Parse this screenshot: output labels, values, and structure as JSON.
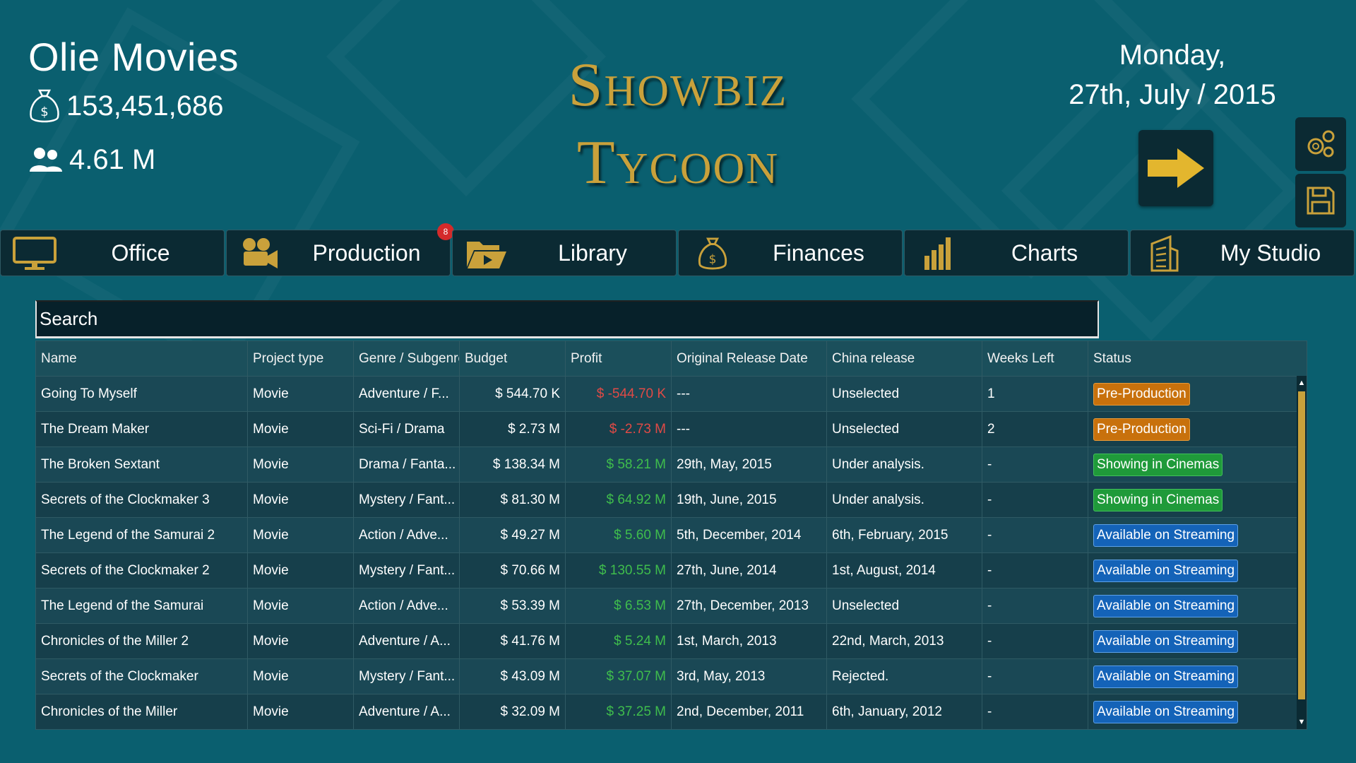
{
  "header": {
    "company_name": "Olie Movies",
    "money": "153,451,686",
    "fans": "4.61 M",
    "date_line1": "Monday,",
    "date_line2": "27th, July / 2015"
  },
  "logo": {
    "line1": "Showbiz",
    "line2": "Tycoon"
  },
  "nav": [
    {
      "label": "Office",
      "icon": "monitor-icon"
    },
    {
      "label": "Production",
      "icon": "camera-icon",
      "badge": "8"
    },
    {
      "label": "Library",
      "icon": "folder-play-icon"
    },
    {
      "label": "Finances",
      "icon": "money-bag-icon"
    },
    {
      "label": "Charts",
      "icon": "bar-chart-icon"
    },
    {
      "label": "My Studio",
      "icon": "building-icon"
    }
  ],
  "search": {
    "placeholder": "Search"
  },
  "colors": {
    "accent_gold": "#c9a13b",
    "bg_teal": "#0a5f6f",
    "panel_dark": "#0b2a33"
  },
  "table": {
    "columns": [
      "Name",
      "Project type",
      "Genre / Subgenre",
      "Budget",
      "Profit",
      "Original Release Date",
      "China release",
      "Weeks Left",
      "Status"
    ],
    "rows": [
      {
        "name": "Going To Myself",
        "type": "Movie",
        "genre": "Adventure / F...",
        "budget": "$ 544.70 K",
        "profit": "$ -544.70 K",
        "profit_sign": "neg",
        "release": "---",
        "china": "Unselected",
        "weeks": "1",
        "status": "Pre-Production",
        "status_kind": "pre"
      },
      {
        "name": "The Dream Maker",
        "type": "Movie",
        "genre": "Sci-Fi / Drama",
        "budget": "$ 2.73 M",
        "profit": "$ -2.73 M",
        "profit_sign": "neg",
        "release": "---",
        "china": "Unselected",
        "weeks": "2",
        "status": "Pre-Production",
        "status_kind": "pre"
      },
      {
        "name": "The Broken Sextant",
        "type": "Movie",
        "genre": "Drama / Fanta...",
        "budget": "$ 138.34 M",
        "profit": "$ 58.21 M",
        "profit_sign": "pos",
        "release": "29th, May, 2015",
        "china": "Under analysis.",
        "weeks": "-",
        "status": "Showing in Cinemas",
        "status_kind": "cine"
      },
      {
        "name": "Secrets of the Clockmaker 3",
        "type": "Movie",
        "genre": "Mystery / Fant...",
        "budget": "$ 81.30 M",
        "profit": "$ 64.92 M",
        "profit_sign": "pos",
        "release": "19th, June, 2015",
        "china": "Under analysis.",
        "weeks": "-",
        "status": "Showing in Cinemas",
        "status_kind": "cine"
      },
      {
        "name": "The Legend of the Samurai 2",
        "type": "Movie",
        "genre": "Action / Adve...",
        "budget": "$ 49.27 M",
        "profit": "$ 5.60 M",
        "profit_sign": "pos",
        "release": "5th, December, 2014",
        "china": "6th, February, 2015",
        "weeks": "-",
        "status": "Available on Streaming",
        "status_kind": "stream"
      },
      {
        "name": "Secrets of the Clockmaker 2",
        "type": "Movie",
        "genre": "Mystery / Fant...",
        "budget": "$ 70.66 M",
        "profit": "$ 130.55 M",
        "profit_sign": "pos",
        "release": "27th, June, 2014",
        "china": "1st, August, 2014",
        "weeks": "-",
        "status": "Available on Streaming",
        "status_kind": "stream"
      },
      {
        "name": "The Legend of the Samurai",
        "type": "Movie",
        "genre": "Action / Adve...",
        "budget": "$ 53.39 M",
        "profit": "$ 6.53 M",
        "profit_sign": "pos",
        "release": "27th, December, 2013",
        "china": "Unselected",
        "weeks": "-",
        "status": "Available on Streaming",
        "status_kind": "stream"
      },
      {
        "name": "Chronicles of the Miller 2",
        "type": "Movie",
        "genre": "Adventure / A...",
        "budget": "$ 41.76 M",
        "profit": "$ 5.24 M",
        "profit_sign": "pos",
        "release": "1st, March, 2013",
        "china": "22nd, March, 2013",
        "weeks": "-",
        "status": "Available on Streaming",
        "status_kind": "stream"
      },
      {
        "name": "Secrets of the Clockmaker",
        "type": "Movie",
        "genre": "Mystery / Fant...",
        "budget": "$ 43.09 M",
        "profit": "$ 37.07 M",
        "profit_sign": "pos",
        "release": "3rd, May, 2013",
        "china": "Rejected.",
        "weeks": "-",
        "status": "Available on Streaming",
        "status_kind": "stream"
      },
      {
        "name": "Chronicles of the Miller",
        "type": "Movie",
        "genre": "Adventure / A...",
        "budget": "$ 32.09 M",
        "profit": "$ 37.25 M",
        "profit_sign": "pos",
        "release": "2nd, December, 2011",
        "china": "6th, January, 2012",
        "weeks": "-",
        "status": "Available on Streaming",
        "status_kind": "stream"
      }
    ]
  }
}
